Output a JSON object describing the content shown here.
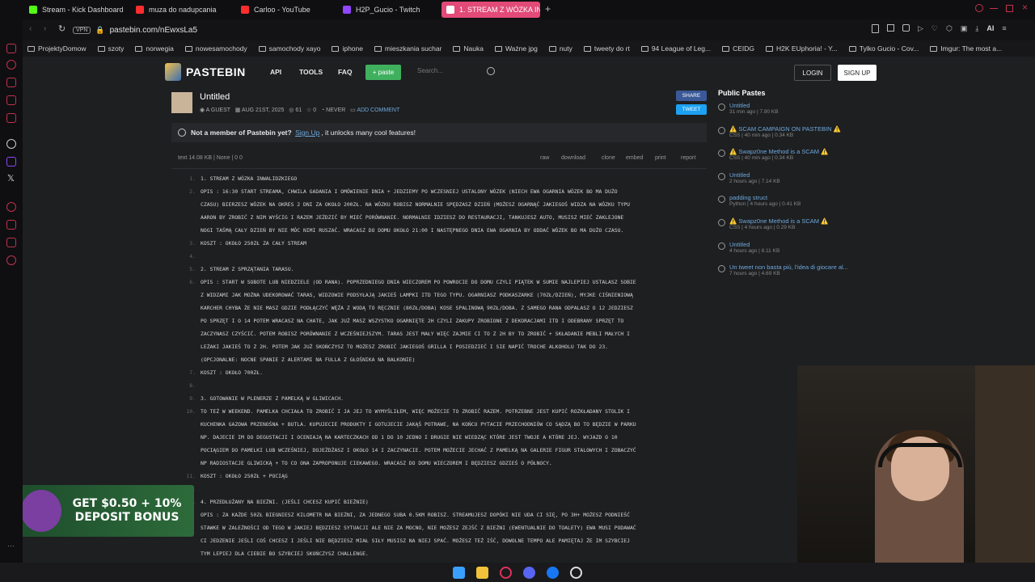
{
  "tabs": [
    {
      "label": "Stream - Kick Dashboard",
      "color": "#53fc18"
    },
    {
      "label": "muza do nadupcania",
      "color": "#ff2d2d"
    },
    {
      "label": "Carloo - YouTube",
      "color": "#ff2d2d"
    },
    {
      "label": "H2P_Gucio - Twitch",
      "color": "#9146ff"
    },
    {
      "label": "1. STREAM Z WÓZKA INW",
      "color": "#ffffff"
    }
  ],
  "address": {
    "vpn": "VPN",
    "url": "pastebin.com/nEwxsLa5"
  },
  "bookmarks": [
    "ProjektyDomow",
    "szoty",
    "norwegia",
    "nowesamochody",
    "samochody xayo",
    "iphone",
    "mieszkania suchar",
    "Nauka",
    "Ważne jpg",
    "nuty",
    "tweety do rt",
    "94 League of Leg...",
    "CEIDG",
    "H2K EUphoria! - Y...",
    "Tylko Gucio - Cov...",
    "Imgur: The most a..."
  ],
  "header": {
    "logo": "PASTEBIN",
    "nav": [
      "API",
      "TOOLS",
      "FAQ"
    ],
    "paste_btn": "+ paste",
    "search_placeholder": "Search...",
    "login": "LOGIN",
    "signup": "SIGN UP"
  },
  "paste": {
    "title": "Untitled",
    "author": "A GUEST",
    "date": "AUG 21ST, 2025",
    "views": "61",
    "stars": "0",
    "expire": "NEVER",
    "comment": "ADD COMMENT",
    "share": "SHARE",
    "tweet": "TWEET"
  },
  "notice": {
    "before": "Not a member of Pastebin yet?",
    "link": "Sign Up",
    "after": ", it unlocks many cool features!"
  },
  "toolbar": {
    "info": "text   14.08 KB  |  None  |  0   0",
    "actions": [
      "raw",
      "download",
      "clone",
      "embed",
      "print",
      "report"
    ]
  },
  "lines": [
    {
      "n": "1.",
      "t": "1. STREAM Z WÓZKA INWALIDZKIEGO"
    },
    {
      "n": "2.",
      "t": "OPIS : 16:30 START STREAMA, CHWILA GADANIA I OMÓWIENIE DNIA + JEDZIEMY PO WCZESNIEJ USTALONY WÓZEK (NIECH EWA OGARNIA WÓZEK BO MA DUŻO"
    },
    {
      "n": "",
      "t": "CZASU) BIERZESZ WÓZEK NA OKRES 2 DNI ZA OKOŁO 200ZŁ. NA WÓZKU ROBISZ NORMALNIE SPĘDZASZ DZIEŃ (MOŻESZ OGARNĄĆ JAKIEGOŚ WIDZA NA WÓZKU TYPU"
    },
    {
      "n": "",
      "t": "AARON BY ZROBIĆ Z NIM WYŚCIG I RAZEM JEŹDZIĆ BY MIEĆ PORÓWNANIE. NORMALNIE IDZIESZ DO RESTAURACJI, TANKUJESZ AUTO, MUSISZ MIEĆ ZAKLEJONE"
    },
    {
      "n": "",
      "t": "NOGI TAŚMĄ CAŁY DZIEŃ BY NIE MÓC NIMI RUSZAĆ. WRACASZ DO DOMU OKOŁO 21:00 I NASTĘPNEGO DNIA EWA OGARNIA BY ODDAĆ WÓZEK BO MA DUŻO CZASU."
    },
    {
      "n": "3.",
      "t": "KOSZT : OKOŁO 250ZŁ ZA CAŁY STREAM"
    },
    {
      "n": "4.",
      "t": ""
    },
    {
      "n": "5.",
      "t": "2. STREAM Z SPRZĄTANIA TARASU."
    },
    {
      "n": "6.",
      "t": "OPIS : START W SOBOTE LUB NIEDZIELE (OD RANA). POPRZEDNIEGO DNIA WIECZOREM PO POWROCIE DO DOMU CZYLI PIĄTEK W SUMIE NAJLEPIEJ USTALASZ SOBIE"
    },
    {
      "n": "",
      "t": "Z WIDZAMI JAK MOŻNA UDEKOROWAĆ TARAS, WIDZOWIE PODSYŁAJĄ JAKIEŚ LAMPKI ITD TEGO TYPU. OGARNIASZ PODKASZARKE (70ZŁ/DZIEŃ), MYJKE CIŚNIENIOWĄ"
    },
    {
      "n": "",
      "t": "KARCHER CHYBA ŻE NIE MASZ GDZIE PODŁĄCZYĆ WĘŻA Z WODĄ TO RĘCZNIE (80ZŁ/DOBA) KOSE SPALINOWĄ 90ZŁ/DOBA. Z SAMEGO RANA ODPALASZ O 12 JEDZIESZ"
    },
    {
      "n": "",
      "t": "PO SPRZĘT I O 14 POTEM WRACASZ NA CHATE, JAK JUŻ MASZ WSZYSTKO OGARNIĘTE 2H CZYLI ZAKUPY ZROBIONE Z DEKORACJAMI ITD I ODEBRANY SPRZĘT TO"
    },
    {
      "n": "",
      "t": "ZACZYNASZ CZYŚCIĆ. POTEM ROBISZ PORÓWNANIE Z WCZEŚNIEJSZYM. TARAS JEST MAŁY WIĘC ZAJMIE CI TO Z 2H BY TO ZROBIĆ + SKŁADANIE MEBLI MAŁYCH I"
    },
    {
      "n": "",
      "t": "LEŻAKI JAKIEŚ TO Z 2H. POTEM JAK JUŻ SKOŃCZYSZ TO MOŻESZ ZROBIĆ JAKIEGOŚ GRILLA I POSIEDZIEĆ I SIE NAPIĆ TROCHE ALKOHOLU TAK DO 23."
    },
    {
      "n": "",
      "t": "(OPCJONALNE: NOCNE SPANIE Z ALERTAMI NA FULLA Z GŁOŚNIKA NA BALKONIE)"
    },
    {
      "n": "7.",
      "t": "KOSZT : OKOŁO 700ZŁ."
    },
    {
      "n": "8.",
      "t": ""
    },
    {
      "n": "9.",
      "t": "3. GOTOWANIE W PLENERZE Z PAMELKĄ W GLIWICACH."
    },
    {
      "n": "10.",
      "t": "TO TEŻ W WEEKEND. PAMELKA CHCIAŁA TO ZROBIĆ I JA JEJ TO WYMYŚLIŁEM, WIĘC MOŻECIE TO ZROBIĆ RAZEM. POTRZEBNE JEST KUPIĆ ROZKŁADANY STOLIK I"
    },
    {
      "n": "",
      "t": "KUCHENKA GAZOWA PRZENOŚNA + BUTLA. KUPUJECIE PRODUKTY I GOTUJECIE JAKĄŚ POTRAWE, NA KOŃCU PYTACIE PRZECHODNIÓW CO SĄDZĄ BO TO BĘDZIE W PARKU"
    },
    {
      "n": "",
      "t": "NP. DAJECIE IM DO DEGUSTACJI I OCENIAJĄ NA KARTECZKACH OD 1 DO 10 JEDNO I DRUGIE NIE WIEDZĄC KTÓRE JEST TWOJE A KTÓRE JEJ. WYJAZD O 10"
    },
    {
      "n": "",
      "t": "POCIĄGIEM DO PAMELKI LUB WCZEŚNIEJ, DOJEŻDŻASZ I OKOŁO 14 I ZACZYNACIE. POTEM MOŻECIE JECHAĆ Z PAMELKĄ NA GALERIE FIGUR STALOWYCH I ZOBACZYĆ"
    },
    {
      "n": "",
      "t": "NP RADIOSTACJE GLIWICKĄ + TO CO ONA ZAPROPONUJE CIEKAWEGO. WRACASZ DO DOMU WIECZOREM I BĘDZIESZ GDZIEŚ O PÓŁNOCY."
    },
    {
      "n": "11.",
      "t": "KOSZT : OKOŁO 250ZŁ + POCIĄG"
    },
    {
      "n": "12.",
      "t": ""
    },
    {
      "n": "13.",
      "t": "4. PRZEDŁUŻANY NA BIEŻNI. (JEŚLI CHCESZ KUPIĆ BIEŻNIE)"
    },
    {
      "n": "",
      "t": "OPIS : ZA KAŻDE 50ZŁ BIEGNIESZ KILOMETR NA BIEŻNI, ZA JEDNEGO SUBA 0.5KM ROBISZ. STREAMUJESZ DOPÓKI NIE UDA CI SIĘ, PO 3H+ MOŻESZ PODNIEŚĆ"
    },
    {
      "n": "",
      "t": "STAWKE W ZALEŻNOŚCI OD TEGO W JAKIEJ BĘDZIESZ SYTUACJI ALE NIE ZA MOCNO, NIE MOŻESZ ZEJŚĆ Z BIEŻNI (EWENTUALNIE DO TOALETY) EWA MUSI PODAWAĆ"
    },
    {
      "n": "",
      "t": "CI JEDZENIE JEŚLI COŚ CHCESZ I JEŚLI NIE BĘDZIESZ MIAŁ SIŁY MUSISZ NA NIEJ SPAĆ. MOŻESZ TEŻ IŚĆ, DOWOLNE TEMPO ALE PAMIĘTAJ ŻE IM SZYBCIEJ"
    },
    {
      "n": "",
      "t": "TYM LEPIEJ DLA CIEBIE BO SZYBCIEJ SKOŃCZYSZ CHALLENGE."
    }
  ],
  "public": {
    "title": "Public Pastes",
    "items": [
      {
        "name": "Untitled",
        "sub": "31 min ago | 7.90 KB"
      },
      {
        "name": "⚠️ SCAM CAMPAIGN ON PASTEBIN ⚠️",
        "sub": "CSS | 40 min ago | 0.34 KB"
      },
      {
        "name": "⚠️ Swapz0ne Method is a SCAM ⚠️",
        "sub": "CSS | 40 min ago | 0.34 KB"
      },
      {
        "name": "Untitled",
        "sub": "2 hours ago | 7.14 KB"
      },
      {
        "name": "padding struct",
        "sub": "Python | 4 hours ago | 0.41 KB"
      },
      {
        "name": "⚠️ Swapz0ne Method is a SCAM ⚠️",
        "sub": "CSS | 4 hours ago | 0.29 KB"
      },
      {
        "name": "Untitled",
        "sub": "4 hours ago | 8.11 KB"
      },
      {
        "name": "Un tweet non basta più, l'idea di giocare al...",
        "sub": "7 hours ago | 4.69 KB"
      }
    ]
  },
  "ad": {
    "text": "GET $0.50 + 10% DEPOSIT BONUS"
  }
}
